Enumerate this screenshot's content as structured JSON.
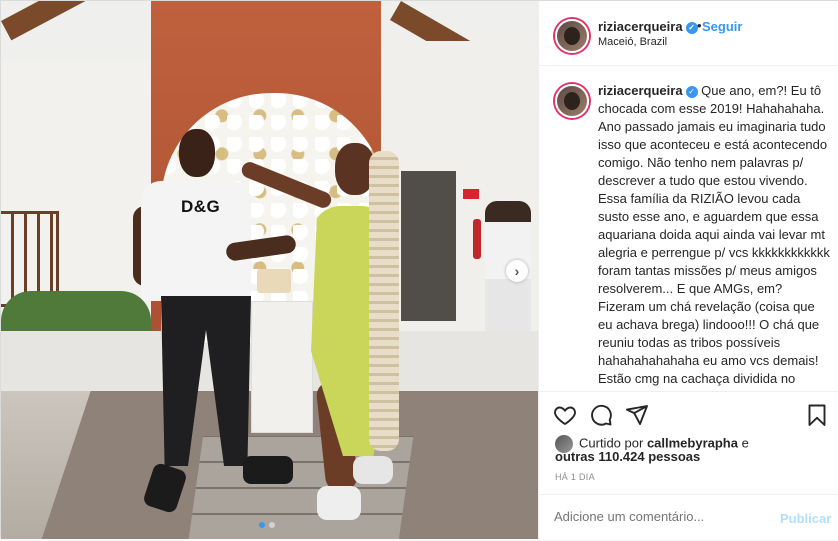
{
  "post": {
    "username": "riziacerqueira",
    "follow_label": "Seguir",
    "separator": "•",
    "location": "Maceió, Brazil",
    "shirt_logo": "D&G",
    "caption_username": "riziacerqueira",
    "caption_text": "Que ano, em?! Eu tô chocada com esse 2019! Hahahahaha. Ano passado jamais eu imaginaria tudo isso que aconteceu e está acontecendo comigo. Não tenho nem palavras p/ descrever a tudo que estou vivendo. Essa família da RIZIÃO levou cada susto esse ano, e aguardem que essa aquariana doida aqui ainda vai levar mt alegria e perrengue p/ vcs kkkkkkkkkkkk foram tantas missões p/ meus amigos resolverem... E que AMGs, em? Fizeram um chá revelação (coisa que eu achava brega) lindooo!!! O chá que reuniu todas as tribos possíveis hahahahahahaha eu amo vcs demais! Estão cmg na cachaça dividida no tempo da faculdade até hoje. Aí",
    "liked_by_prefix": "Curtido por",
    "liked_by_user": "callmebyrapha",
    "liked_by_and": "e",
    "others_count": "outras 110.424 pessoas",
    "time_ago": "HÁ 1 DIA",
    "comment_placeholder": "Adicione um comentário...",
    "publish_label": "Publicar",
    "carousel": {
      "slides": 2,
      "active_index": 0
    },
    "colors": {
      "accent": "#3897f0",
      "publish_disabled": "#b2dffc",
      "story_ring": "#e1306c"
    },
    "icons": [
      "heart-icon",
      "comment-icon",
      "share-icon",
      "bookmark-icon",
      "verified-icon",
      "chevron-right-icon"
    ]
  }
}
